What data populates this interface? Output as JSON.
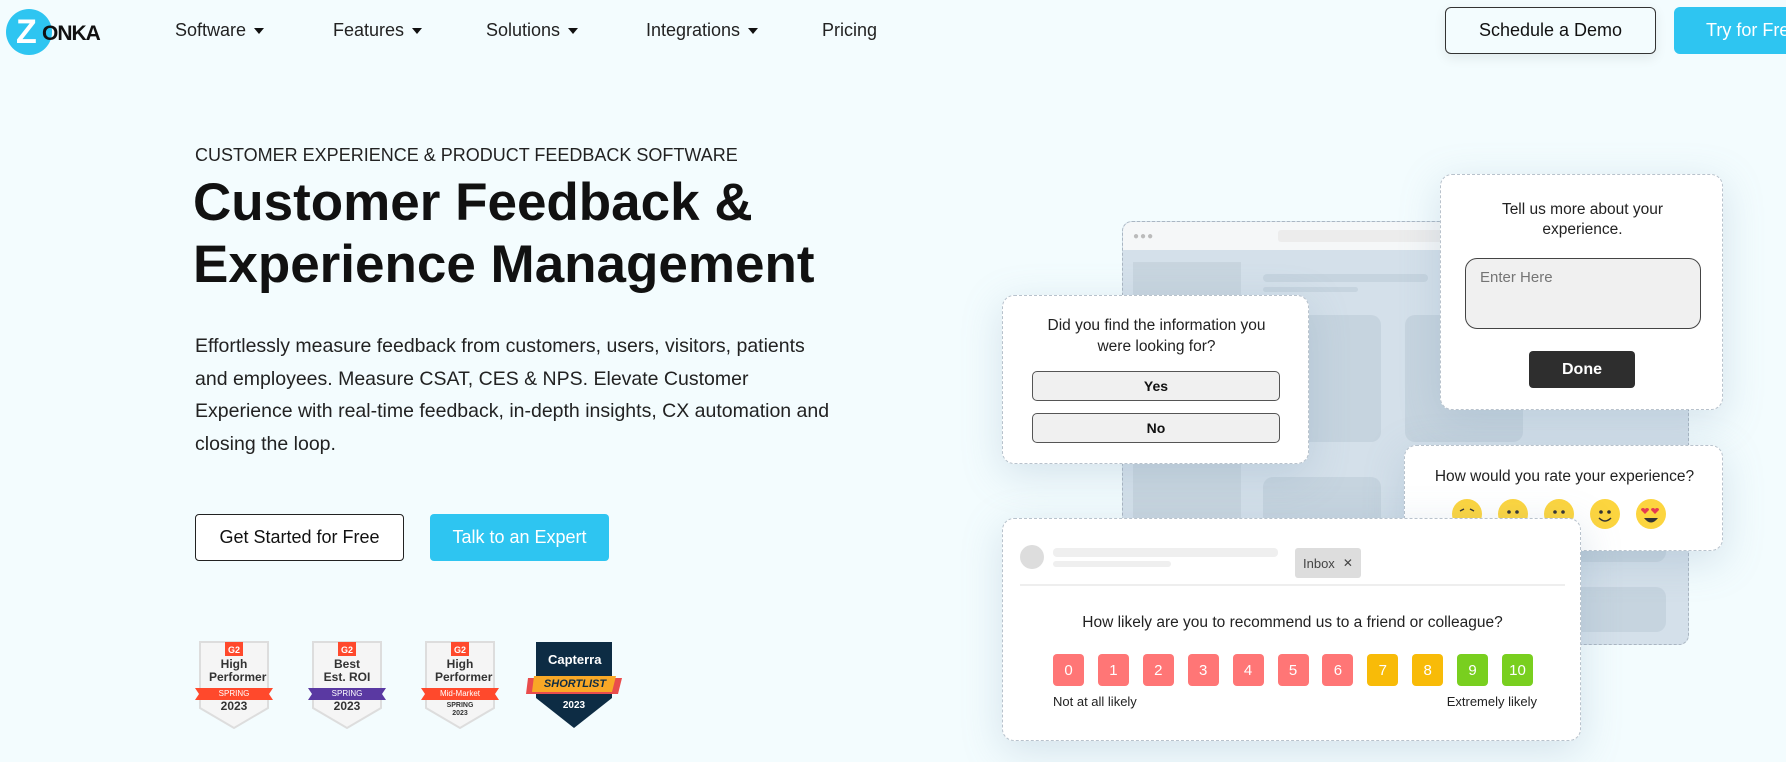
{
  "brand": {
    "logo_text": "ZONKA",
    "accent": "#2ec5f1"
  },
  "nav": {
    "items": [
      {
        "label": "Software",
        "dropdown": true
      },
      {
        "label": "Features",
        "dropdown": true
      },
      {
        "label": "Solutions",
        "dropdown": true
      },
      {
        "label": "Integrations",
        "dropdown": true
      },
      {
        "label": "Pricing",
        "dropdown": false
      }
    ],
    "schedule_demo": "Schedule a Demo",
    "try_free": "Try for Free"
  },
  "hero": {
    "eyebrow": "CUSTOMER EXPERIENCE & PRODUCT FEEDBACK SOFTWARE",
    "title_line1": "Customer Feedback &",
    "title_line2": "Experience Management",
    "description": "Effortlessly measure feedback from customers, users, visitors, patients and employees. Measure CSAT, CES & NPS. Elevate Customer Experience with real-time feedback, in-depth insights, CX automation and closing the loop.",
    "get_started": "Get Started for Free",
    "talk_expert": "Talk to an Expert"
  },
  "badges": [
    {
      "brand": "G2",
      "title": "High Performer",
      "ribbon": "SPRING",
      "year": "2023",
      "ribbon_color": "#ff492c"
    },
    {
      "brand": "G2",
      "title": "Best Est. ROI",
      "ribbon": "SPRING",
      "year": "2023",
      "ribbon_color": "#5a39a2"
    },
    {
      "brand": "G2",
      "title": "High Performer",
      "ribbon": "Mid-Market",
      "year": "SPRING 2023",
      "ribbon_color": "#ff492c"
    },
    {
      "brand": "Capterra",
      "title": "SHORTLIST",
      "year": "2023"
    }
  ],
  "widgets": {
    "info": {
      "question": "Did you find the information you were looking for?",
      "yes": "Yes",
      "no": "No"
    },
    "more": {
      "question": "Tell us more about your experience.",
      "placeholder": "Enter Here",
      "done": "Done"
    },
    "rate": {
      "question": "How would you rate your experience?",
      "emojis": [
        "tired-face",
        "frowning-face",
        "neutral-face",
        "slightly-smiling-face",
        "heart-eyes-face"
      ]
    },
    "nps": {
      "tag": "Inbox",
      "question": "How likely are you to recommend us to a friend or colleague?",
      "scale": [
        "0",
        "1",
        "2",
        "3",
        "4",
        "5",
        "6",
        "7",
        "8",
        "9",
        "10"
      ],
      "low_label": "Not at all likely",
      "high_label": "Extremely likely",
      "colors": {
        "detractor": "#ff7676",
        "passive": "#f8bb08",
        "promoter": "#79cf1f"
      }
    }
  }
}
